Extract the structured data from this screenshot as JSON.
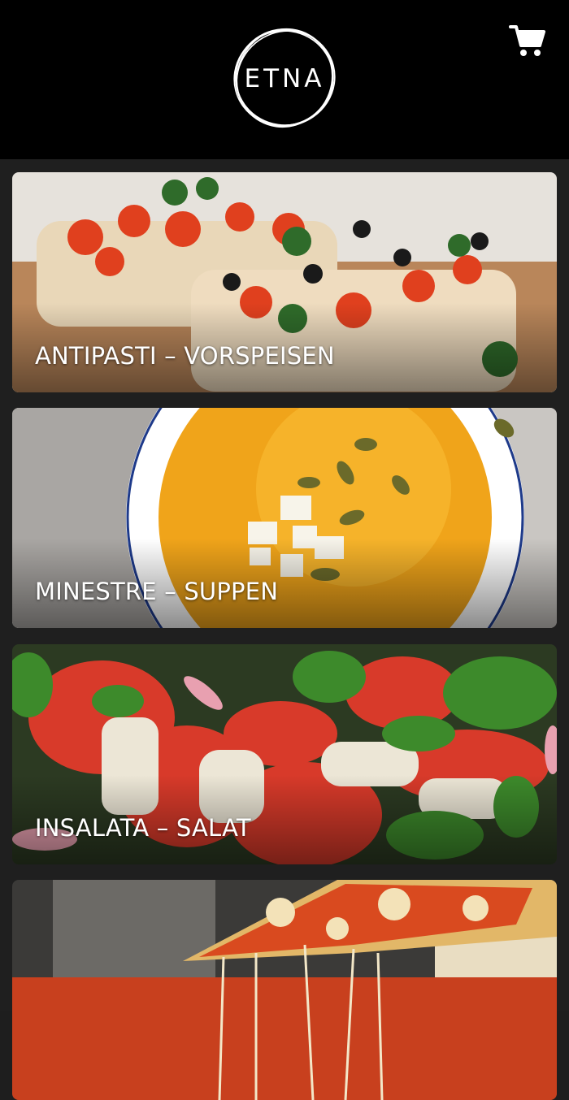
{
  "header": {
    "logo_text": "ETNA",
    "cart_icon": "shopping-cart-icon"
  },
  "categories": [
    {
      "label": "ANTIPASTI – VORSPEISEN"
    },
    {
      "label": "MINESTRE – SUPPEN"
    },
    {
      "label": "INSALATA – SALAT"
    },
    {
      "label": ""
    }
  ],
  "colors": {
    "header_bg": "#000000",
    "page_bg": "#1f1f1f",
    "label_text": "#ffffff"
  }
}
